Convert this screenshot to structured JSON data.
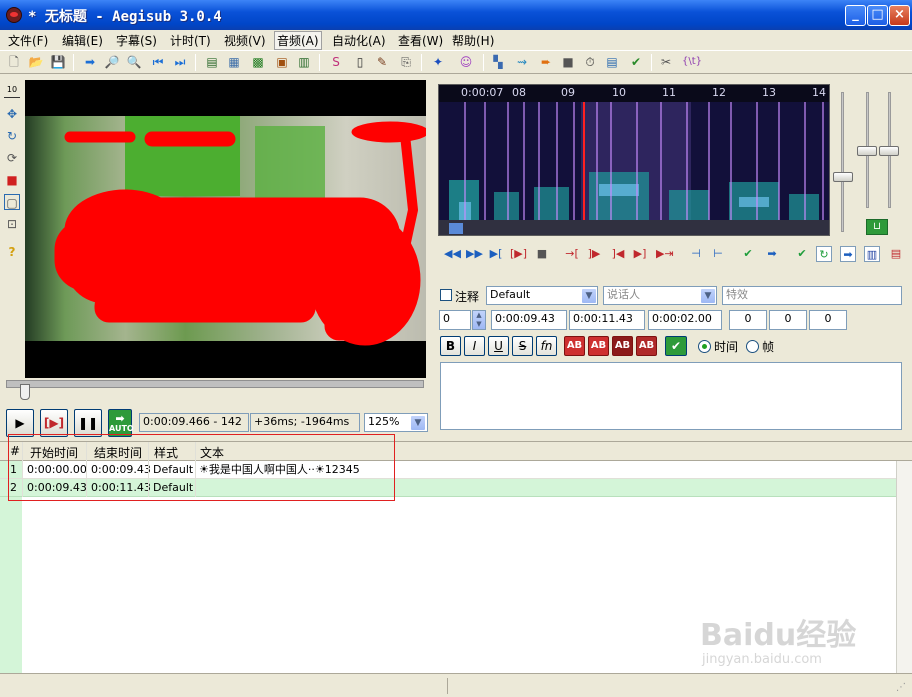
{
  "window": {
    "title": "* 无标题 - Aegisub 3.0.4",
    "minimize": "_",
    "maximize": "□",
    "close": "×"
  },
  "menu": [
    "文件(F)",
    "编辑(E)",
    "字幕(S)",
    "计时(T)",
    "视频(V)",
    "音频(A)",
    "自动化(A)",
    "查看(W)",
    "帮助(H)"
  ],
  "video": {
    "time_display": "0:00:09.466 - 142",
    "offset_display": "+36ms; -1964ms",
    "zoom": "125%",
    "auto_label": "AUTO"
  },
  "audio": {
    "ruler_labels": [
      "0:00:07",
      "08",
      "09",
      "10",
      "11",
      "12",
      "13",
      "14"
    ]
  },
  "editbox": {
    "comment_label": "注释",
    "style": "Default",
    "actor_placeholder": "说话人",
    "effect_placeholder": "特效",
    "layer": "0",
    "start_time": "0:00:09.43",
    "end_time": "0:00:11.43",
    "duration": "0:00:02.00",
    "margin_l": "0",
    "margin_r": "0",
    "margin_v": "0",
    "bold": "B",
    "italic": "I",
    "underline": "U",
    "strike": "S",
    "font": "fn",
    "color_labels": [
      "AB",
      "AB",
      "AB",
      "AB"
    ],
    "time_radio": "时间",
    "frame_radio": "帧",
    "text": ""
  },
  "grid": {
    "headers": [
      "#",
      "开始时间",
      "结束时间",
      "样式",
      "文本"
    ],
    "rows": [
      {
        "num": "1",
        "start": "0:00:00.00",
        "end": "0:00:09.43",
        "style": "Default",
        "text": "☀我是中国人啊中国人··☀12345"
      },
      {
        "num": "2",
        "start": "0:00:09.43",
        "end": "0:00:11.43",
        "style": "Default",
        "text": ""
      }
    ]
  },
  "colors": {
    "titlebar": "#0a52d8",
    "selected_row": "#d4f5d8",
    "highlight_box": "#e02020",
    "scribble": "#ff0000"
  },
  "watermark": {
    "brand": "Baidu经验",
    "url": "jingyan.baidu.com"
  }
}
